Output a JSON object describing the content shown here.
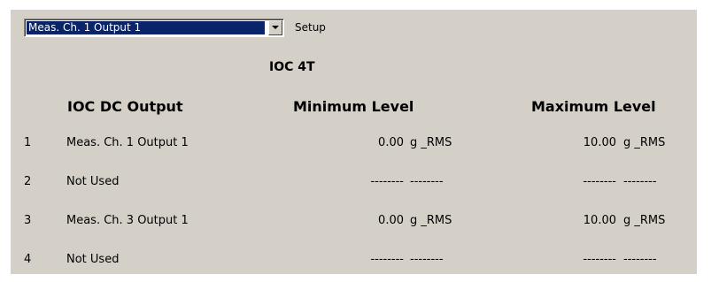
{
  "selector": {
    "value": "Meas. Ch. 1 Output 1",
    "setup_label": "Setup"
  },
  "title": "IOC 4T",
  "columns": {
    "output": "IOC DC Output",
    "minimum": "Minimum Level",
    "maximum": "Maximum Level"
  },
  "rows": [
    {
      "num": "1",
      "name": "Meas. Ch. 1 Output 1",
      "min_value": "0.00",
      "min_unit": "g _RMS",
      "max_value": "10.00",
      "max_unit": "g _RMS"
    },
    {
      "num": "2",
      "name": "Not Used",
      "min_value": "--------",
      "min_unit": "--------",
      "max_value": "--------",
      "max_unit": "--------"
    },
    {
      "num": "3",
      "name": "Meas. Ch. 3 Output 1",
      "min_value": "0.00",
      "min_unit": "g _RMS",
      "max_value": "10.00",
      "max_unit": "g _RMS"
    },
    {
      "num": "4",
      "name": "Not Used",
      "min_value": "--------",
      "min_unit": "--------",
      "max_value": "--------",
      "max_unit": "--------"
    }
  ]
}
